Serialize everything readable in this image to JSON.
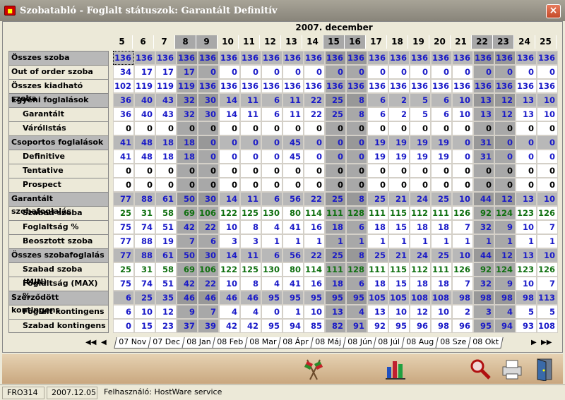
{
  "window": {
    "title": "Szobatabló - Foglalt státuszok: Garantált Definitív",
    "close": "×"
  },
  "month": "2007. december",
  "days": [
    "5",
    "6",
    "7",
    "8",
    "9",
    "10",
    "11",
    "12",
    "13",
    "14",
    "15",
    "16",
    "17",
    "18",
    "19",
    "20",
    "21",
    "22",
    "23",
    "24",
    "25"
  ],
  "weekend_cols": [
    3,
    4,
    10,
    11,
    17,
    18
  ],
  "rows": [
    {
      "label": "Összes szoba",
      "style": "grp",
      "color": "blue",
      "vals": [
        136,
        136,
        136,
        136,
        136,
        136,
        136,
        136,
        136,
        136,
        136,
        136,
        136,
        136,
        136,
        136,
        136,
        136,
        136,
        136,
        136
      ]
    },
    {
      "label": "Out of order szoba",
      "style": "",
      "color": "blue",
      "vals": [
        34,
        17,
        17,
        17,
        0,
        0,
        0,
        0,
        0,
        0,
        0,
        0,
        0,
        0,
        0,
        0,
        0,
        0,
        0,
        0,
        0
      ]
    },
    {
      "label": "Összes kiadható szoba",
      "style": "",
      "color": "blue",
      "vals": [
        102,
        119,
        119,
        119,
        136,
        136,
        136,
        136,
        136,
        136,
        136,
        136,
        136,
        136,
        136,
        136,
        136,
        136,
        136,
        136,
        136
      ]
    },
    {
      "label": "Egyéni foglalások",
      "style": "grp",
      "color": "blue",
      "vals": [
        36,
        40,
        43,
        32,
        30,
        14,
        11,
        6,
        11,
        22,
        25,
        8,
        6,
        2,
        5,
        6,
        10,
        13,
        12,
        13,
        10
      ]
    },
    {
      "label": "Garantált",
      "style": "sub",
      "color": "blue",
      "vals": [
        36,
        40,
        43,
        32,
        30,
        14,
        11,
        6,
        11,
        22,
        25,
        8,
        6,
        2,
        5,
        6,
        10,
        13,
        12,
        13,
        10
      ]
    },
    {
      "label": "Várólistás",
      "style": "sub",
      "color": "black",
      "vals": [
        0,
        0,
        0,
        0,
        0,
        0,
        0,
        0,
        0,
        0,
        0,
        0,
        0,
        0,
        0,
        0,
        0,
        0,
        0,
        0,
        0
      ]
    },
    {
      "label": "Csoportos foglalások",
      "style": "grp",
      "color": "blue",
      "vals": [
        41,
        48,
        18,
        18,
        0,
        0,
        0,
        0,
        45,
        0,
        0,
        0,
        19,
        19,
        19,
        19,
        0,
        31,
        0,
        0,
        0
      ]
    },
    {
      "label": "Definitive",
      "style": "sub",
      "color": "blue",
      "vals": [
        41,
        48,
        18,
        18,
        0,
        0,
        0,
        0,
        45,
        0,
        0,
        0,
        19,
        19,
        19,
        19,
        0,
        31,
        0,
        0,
        0
      ]
    },
    {
      "label": "Tentative",
      "style": "sub",
      "color": "black",
      "vals": [
        0,
        0,
        0,
        0,
        0,
        0,
        0,
        0,
        0,
        0,
        0,
        0,
        0,
        0,
        0,
        0,
        0,
        0,
        0,
        0,
        0
      ]
    },
    {
      "label": "Prospect",
      "style": "sub",
      "color": "black",
      "vals": [
        0,
        0,
        0,
        0,
        0,
        0,
        0,
        0,
        0,
        0,
        0,
        0,
        0,
        0,
        0,
        0,
        0,
        0,
        0,
        0,
        0
      ]
    },
    {
      "label": "Garantált szobafoglalás",
      "style": "grp",
      "color": "blue",
      "vals": [
        77,
        88,
        61,
        50,
        30,
        14,
        11,
        6,
        56,
        22,
        25,
        8,
        25,
        21,
        24,
        25,
        10,
        44,
        12,
        13,
        10
      ]
    },
    {
      "label": "Szabad szoba",
      "style": "sub",
      "color": "green",
      "vals": [
        25,
        31,
        58,
        69,
        106,
        122,
        125,
        130,
        80,
        114,
        111,
        128,
        111,
        115,
        112,
        111,
        126,
        92,
        124,
        123,
        126
      ]
    },
    {
      "label": "Foglaltság %",
      "style": "sub",
      "color": "blue",
      "vals": [
        75,
        74,
        51,
        42,
        22,
        10,
        8,
        4,
        41,
        16,
        18,
        6,
        18,
        15,
        18,
        18,
        7,
        32,
        9,
        10,
        7
      ]
    },
    {
      "label": "Beosztott szoba",
      "style": "sub",
      "color": "blue",
      "vals": [
        77,
        88,
        19,
        7,
        6,
        3,
        3,
        1,
        1,
        1,
        1,
        1,
        1,
        1,
        1,
        1,
        1,
        1,
        1,
        1,
        1
      ]
    },
    {
      "label": "Összes szobafoglalás",
      "style": "grp",
      "color": "blue",
      "vals": [
        77,
        88,
        61,
        50,
        30,
        14,
        11,
        6,
        56,
        22,
        25,
        8,
        25,
        21,
        24,
        25,
        10,
        44,
        12,
        13,
        10
      ]
    },
    {
      "label": "Szabad szoba (MIN)",
      "style": "sub",
      "color": "green",
      "vals": [
        25,
        31,
        58,
        69,
        106,
        122,
        125,
        130,
        80,
        114,
        111,
        128,
        111,
        115,
        112,
        111,
        126,
        92,
        124,
        123,
        126
      ]
    },
    {
      "label": "Foglaltság (MAX) %",
      "style": "sub",
      "color": "blue",
      "vals": [
        75,
        74,
        51,
        42,
        22,
        10,
        8,
        4,
        41,
        16,
        18,
        6,
        18,
        15,
        18,
        18,
        7,
        32,
        9,
        10,
        7
      ]
    },
    {
      "label": "Szerződött kontingens",
      "style": "grp",
      "color": "blue",
      "vals": [
        6,
        25,
        35,
        46,
        46,
        46,
        46,
        95,
        95,
        95,
        95,
        95,
        105,
        105,
        108,
        108,
        98,
        98,
        98,
        98,
        113
      ]
    },
    {
      "label": "Foglalt kontingens",
      "style": "sub",
      "color": "blue",
      "vals": [
        6,
        10,
        12,
        9,
        7,
        4,
        4,
        0,
        1,
        10,
        13,
        4,
        13,
        10,
        12,
        10,
        2,
        3,
        4,
        5,
        5
      ]
    },
    {
      "label": "Szabad kontingens",
      "style": "sub",
      "color": "blue",
      "vals": [
        0,
        15,
        23,
        37,
        39,
        42,
        42,
        95,
        94,
        85,
        82,
        91,
        92,
        95,
        96,
        98,
        96,
        95,
        94,
        93,
        108
      ]
    }
  ],
  "tabs": [
    "07 Nov",
    "07 Dec",
    "08 Jan",
    "08 Feb",
    "08 Mar",
    "08 Ápr",
    "08 Máj",
    "08 Jún",
    "08 Júl",
    "08 Aug",
    "08 Sze",
    "08 Okt"
  ],
  "active_tab": "07 Dec",
  "status": {
    "code": "FRO314",
    "date": "2007.12.05",
    "user": "Felhasználó: HostWare service"
  },
  "colors": {
    "blue": "#1a1ac8",
    "green": "#107010",
    "grp": "#b8b8b8",
    "weekend": "#a8a8a8"
  }
}
